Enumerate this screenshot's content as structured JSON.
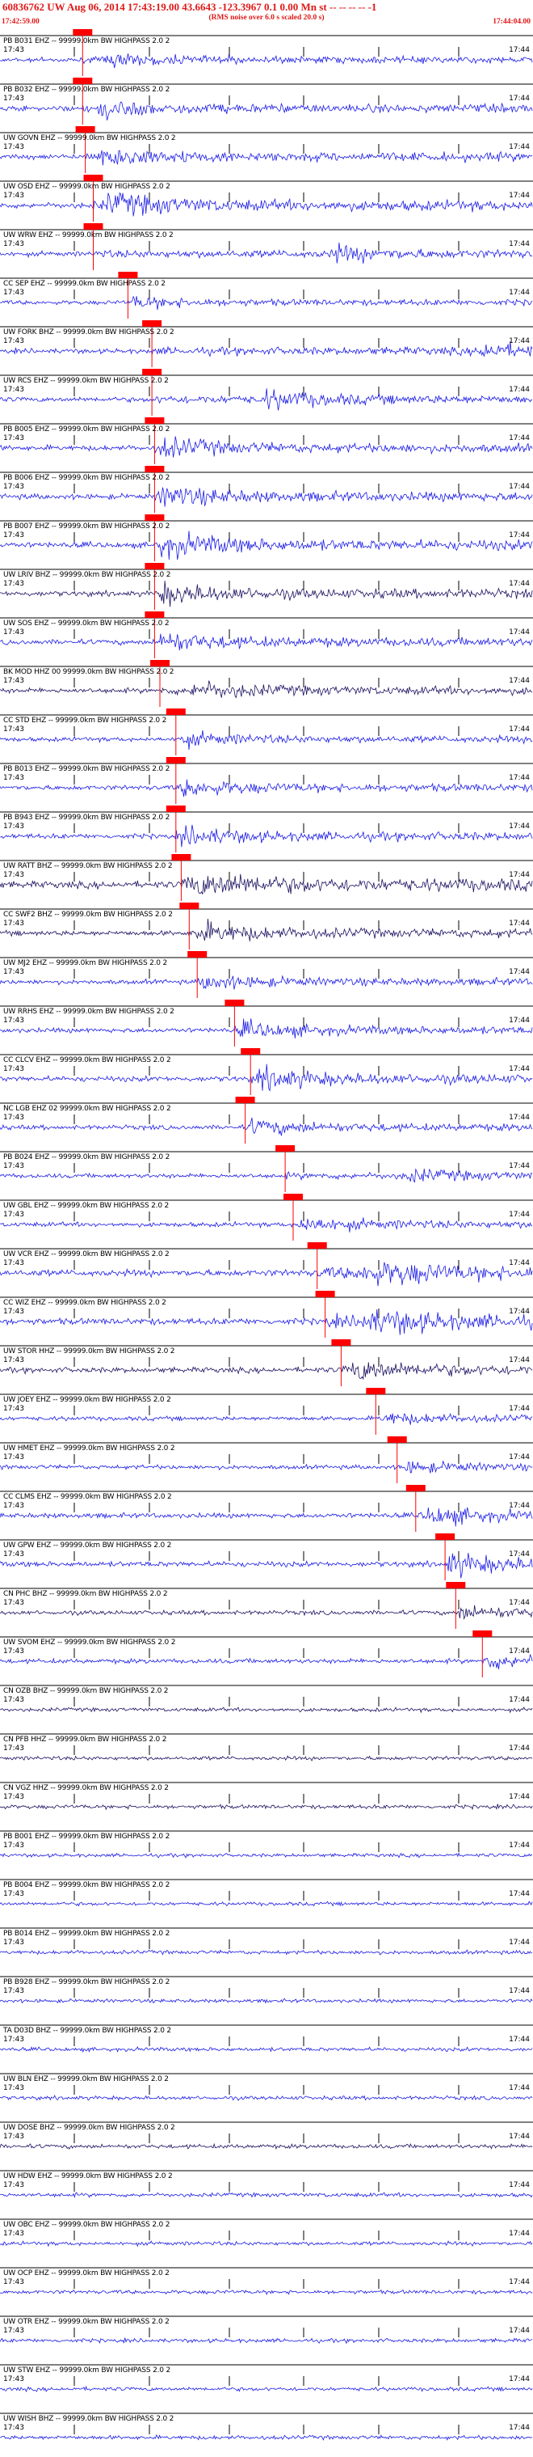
{
  "header": {
    "title": "60836762 UW Aug 06, 2014 17:43:19.00   43.6643 -123.3967  0.1 0.00 Mn st -- -- -- --  -1",
    "subtitle": "(RMS noise over 6.0 s scaled 20.0 s)",
    "start_time": "17:42:59.00",
    "end_time": "17:44:04.00"
  },
  "colors": {
    "header_red": "#e01818",
    "trace_blue": "#1a1ae6",
    "trace_dark": "#1a1060",
    "pick_red": "#ff0000"
  },
  "time_labels": {
    "left": "17:43",
    "right": "17:44"
  },
  "traces": [
    {
      "label": "PB B031 EHZ -- 99999.0km BW  HIGHPASS  2.0  2",
      "pick": 0.155,
      "event": 0.2,
      "amp": 0.35,
      "color": "blue"
    },
    {
      "label": "PB B032 EHZ -- 99999.0km BW  HIGHPASS  2.0  2",
      "pick": 0.155,
      "event": 0.18,
      "amp": 0.5,
      "color": "blue"
    },
    {
      "label": "UW GOVN EHZ -- 99999.0km BW  HIGHPASS  2.0  2",
      "pick": 0.16,
      "event": 0.19,
      "amp": 0.55,
      "color": "blue"
    },
    {
      "label": "UW OSD EHZ -- 99999.0km BW  HIGHPASS  2.0  2",
      "pick": 0.175,
      "event": 0.2,
      "amp": 0.7,
      "color": "blue"
    },
    {
      "label": "UW WRW EHZ -- 99999.0km BW  HIGHPASS  2.0  2",
      "pick": 0.175,
      "event": 0.62,
      "amp": 0.45,
      "color": "blue"
    },
    {
      "label": "CC SEP EHZ -- 99999.0km BW  HIGHPASS  2.0  2",
      "pick": 0.24,
      "event": 0.25,
      "amp": 0.3,
      "color": "blue"
    },
    {
      "label": "UW FORK BHZ -- 99999.0km BW  HIGHPASS  2.0  2",
      "pick": 0.285,
      "event": 0.9,
      "amp": 0.45,
      "color": "blue"
    },
    {
      "label": "UW RCS EHZ -- 99999.0km BW  HIGHPASS  2.0  2",
      "pick": 0.285,
      "event": 0.5,
      "amp": 0.5,
      "color": "blue"
    },
    {
      "label": "PB B005 EHZ -- 99999.0km BW  HIGHPASS  2.0  2",
      "pick": 0.29,
      "event": 0.3,
      "amp": 0.55,
      "color": "blue"
    },
    {
      "label": "PB B006 EHZ -- 99999.0km BW  HIGHPASS  2.0  2",
      "pick": 0.29,
      "event": 0.3,
      "amp": 0.6,
      "color": "blue"
    },
    {
      "label": "PB B007 EHZ -- 99999.0km BW  HIGHPASS  2.0  2",
      "pick": 0.29,
      "event": 0.3,
      "amp": 0.7,
      "color": "blue"
    },
    {
      "label": "UW LRIV BHZ -- 99999.0km BW  HIGHPASS  2.0  2",
      "pick": 0.29,
      "event": 0.3,
      "amp": 0.6,
      "color": "dark"
    },
    {
      "label": "UW SOS EHZ -- 99999.0km BW  HIGHPASS  2.0  2",
      "pick": 0.29,
      "event": 0.3,
      "amp": 0.55,
      "color": "blue"
    },
    {
      "label": "BK MOD HHZ 00 99999.0km BW  HIGHPASS  2.0  2",
      "pick": 0.3,
      "event": 0.36,
      "amp": 0.5,
      "color": "dark"
    },
    {
      "label": "CC STD EHZ -- 99999.0km BW  HIGHPASS  2.0  2",
      "pick": 0.33,
      "event": 0.34,
      "amp": 0.35,
      "color": "blue"
    },
    {
      "label": "PB B013 EHZ -- 99999.0km BW  HIGHPASS  2.0  2",
      "pick": 0.33,
      "event": 0.34,
      "amp": 0.45,
      "color": "blue"
    },
    {
      "label": "PB B943 EHZ -- 99999.0km BW  HIGHPASS  2.0  2",
      "pick": 0.33,
      "event": 0.34,
      "amp": 0.5,
      "color": "blue"
    },
    {
      "label": "UW RATT BHZ -- 99999.0km BW  HIGHPASS  2.0  2",
      "pick": 0.34,
      "event": 0.35,
      "amp": 0.95,
      "color": "dark"
    },
    {
      "label": "CC SWF2 BHZ -- 99999.0km BW  HIGHPASS  2.0  2",
      "pick": 0.355,
      "event": 0.37,
      "amp": 0.55,
      "color": "dark"
    },
    {
      "label": "UW MJ2 EHZ -- 99999.0km BW  HIGHPASS  2.0  2",
      "pick": 0.37,
      "event": 0.38,
      "amp": 0.4,
      "color": "blue"
    },
    {
      "label": "UW RRHS EHZ -- 99999.0km BW  HIGHPASS  2.0  2",
      "pick": 0.44,
      "event": 0.45,
      "amp": 0.45,
      "color": "blue"
    },
    {
      "label": "CC CLCV EHZ -- 99999.0km BW  HIGHPASS  2.0  2",
      "pick": 0.47,
      "event": 0.48,
      "amp": 0.6,
      "color": "blue"
    },
    {
      "label": "NC LGB EHZ 02 99999.0km BW  HIGHPASS  2.0  2",
      "pick": 0.46,
      "event": 0.47,
      "amp": 0.4,
      "color": "blue"
    },
    {
      "label": "PB B024 EHZ -- 99999.0km BW  HIGHPASS  2.0  2",
      "pick": 0.535,
      "event": 0.76,
      "amp": 0.35,
      "color": "blue"
    },
    {
      "label": "UW GBL EHZ -- 99999.0km BW  HIGHPASS  2.0  2",
      "pick": 0.55,
      "event": 0.56,
      "amp": 0.4,
      "color": "blue"
    },
    {
      "label": "UW VCR EHZ -- 99999.0km BW  HIGHPASS  2.0  2",
      "pick": 0.595,
      "event": 0.68,
      "amp": 0.9,
      "color": "blue"
    },
    {
      "label": "CC WIZ EHZ -- 99999.0km BW  HIGHPASS  2.0  2",
      "pick": 0.61,
      "event": 0.68,
      "amp": 0.9,
      "color": "blue"
    },
    {
      "label": "UW STOR HHZ -- 99999.0km BW  HIGHPASS  2.0  2",
      "pick": 0.64,
      "event": 0.66,
      "amp": 0.6,
      "color": "dark"
    },
    {
      "label": "UW JOEY EHZ -- 99999.0km BW  HIGHPASS  2.0  2",
      "pick": 0.705,
      "event": 0.72,
      "amp": 0.3,
      "color": "blue"
    },
    {
      "label": "UW HMET EHZ -- 99999.0km BW  HIGHPASS  2.0  2",
      "pick": 0.745,
      "event": 0.76,
      "amp": 0.3,
      "color": "blue"
    },
    {
      "label": "CC CLMS EHZ -- 99999.0km BW  HIGHPASS  2.0  2",
      "pick": 0.78,
      "event": 0.8,
      "amp": 0.5,
      "color": "blue"
    },
    {
      "label": "UW GPW EHZ -- 99999.0km BW  HIGHPASS  2.0  2",
      "pick": 0.835,
      "event": 0.84,
      "amp": 0.6,
      "color": "blue"
    },
    {
      "label": "CN PHC BHZ -- 99999.0km BW  HIGHPASS  2.0  2",
      "pick": 0.855,
      "event": 0.86,
      "amp": 0.35,
      "color": "dark"
    },
    {
      "label": "UW SVOM EHZ -- 99999.0km BW  HIGHPASS  2.0  2",
      "pick": 0.905,
      "event": 0.91,
      "amp": 0.4,
      "color": "blue"
    },
    {
      "label": "CN OZB BHZ -- 99999.0km BW  HIGHPASS  2.0  2",
      "pick": -1,
      "event": -1,
      "amp": 0.2,
      "color": "dark"
    },
    {
      "label": "CN PFB HHZ -- 99999.0km BW  HIGHPASS  2.0  2",
      "pick": -1,
      "event": -1,
      "amp": 0.2,
      "color": "dark"
    },
    {
      "label": "CN VGZ HHZ -- 99999.0km BW  HIGHPASS  2.0  2",
      "pick": -1,
      "event": -1,
      "amp": 0.25,
      "color": "dark"
    },
    {
      "label": "PB B001 EHZ -- 99999.0km BW  HIGHPASS  2.0  2",
      "pick": -1,
      "event": -1,
      "amp": 0.1,
      "color": "blue"
    },
    {
      "label": "PB B004 EHZ -- 99999.0km BW  HIGHPASS  2.0  2",
      "pick": -1,
      "event": -1,
      "amp": 0.15,
      "color": "blue"
    },
    {
      "label": "PB B014 EHZ -- 99999.0km BW  HIGHPASS  2.0  2",
      "pick": -1,
      "event": -1,
      "amp": 0.2,
      "color": "blue"
    },
    {
      "label": "PB B928 EHZ -- 99999.0km BW  HIGHPASS  2.0  2",
      "pick": -1,
      "event": -1,
      "amp": 0.15,
      "color": "blue"
    },
    {
      "label": "TA D03D BHZ -- 99999.0km BW  HIGHPASS  2.0  2",
      "pick": -1,
      "event": -1,
      "amp": 0.2,
      "color": "blue"
    },
    {
      "label": "UW BLN EHZ -- 99999.0km BW  HIGHPASS  2.0  2",
      "pick": -1,
      "event": -1,
      "amp": 0.2,
      "color": "blue"
    },
    {
      "label": "UW DOSE BHZ -- 99999.0km BW  HIGHPASS  2.0  2",
      "pick": -1,
      "event": -1,
      "amp": 0.3,
      "color": "dark"
    },
    {
      "label": "UW HDW EHZ -- 99999.0km BW  HIGHPASS  2.0  2",
      "pick": -1,
      "event": -1,
      "amp": 0.25,
      "color": "blue"
    },
    {
      "label": "UW OBC EHZ -- 99999.0km BW  HIGHPASS  2.0  2",
      "pick": -1,
      "event": -1,
      "amp": 0.2,
      "color": "blue"
    },
    {
      "label": "UW OCP EHZ -- 99999.0km BW  HIGHPASS  2.0  2",
      "pick": -1,
      "event": -1,
      "amp": 0.2,
      "color": "blue"
    },
    {
      "label": "UW OTR EHZ -- 99999.0km BW  HIGHPASS  2.0  2",
      "pick": -1,
      "event": -1,
      "amp": 0.2,
      "color": "blue"
    },
    {
      "label": "UW STW EHZ -- 99999.0km BW  HIGHPASS  2.0  2",
      "pick": -1,
      "event": -1,
      "amp": 0.2,
      "color": "blue"
    },
    {
      "label": "UW WISH BHZ -- 99999.0km BW  HIGHPASS  2.0  2",
      "pick": -1,
      "event": -1,
      "amp": 0.25,
      "color": "blue"
    }
  ]
}
